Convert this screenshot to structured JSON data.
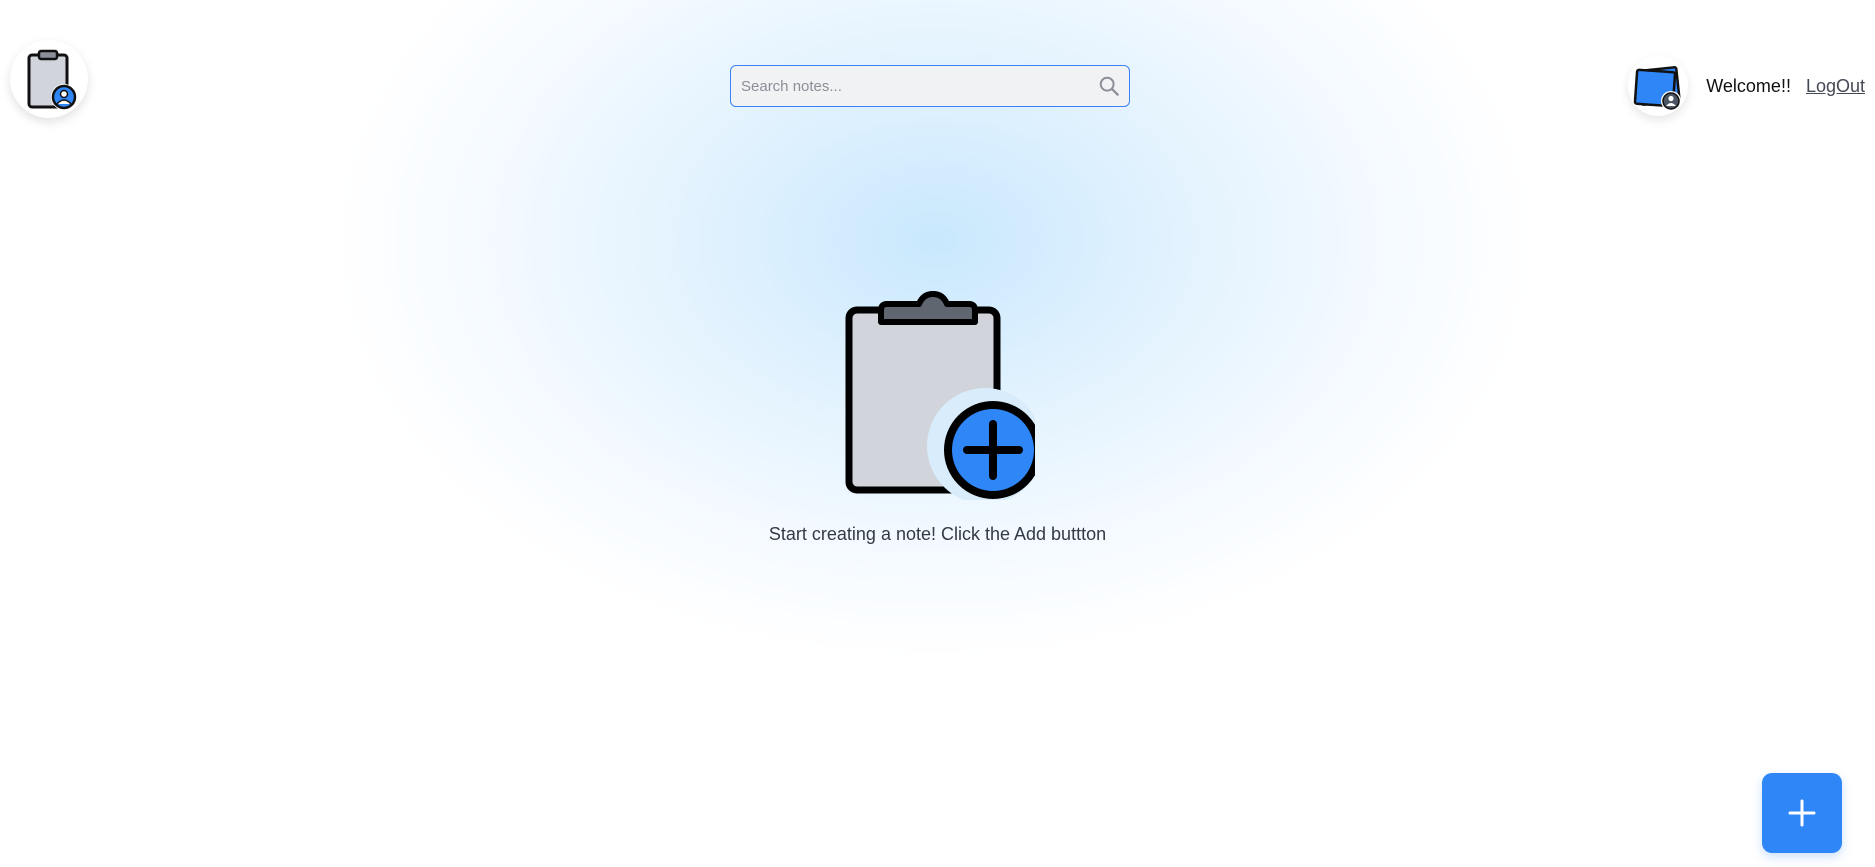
{
  "header": {
    "logo_icon": "clipboard-user-icon",
    "search": {
      "placeholder": "Search notes...",
      "value": "",
      "icon": "search-icon"
    },
    "user": {
      "avatar_icon": "notes-user-avatar-icon",
      "welcome_text": "Welcome!!",
      "logout_label": "LogOut"
    }
  },
  "main": {
    "empty_state": {
      "icon": "clipboard-add-icon",
      "message": "Start creating a note! Click the Add buttton"
    }
  },
  "fab": {
    "icon": "plus-icon",
    "symbol": "+"
  },
  "colors": {
    "accent": "#2f86f6",
    "background_glow": "#c9e8fd",
    "clipboard_fill": "#d1d5db"
  }
}
